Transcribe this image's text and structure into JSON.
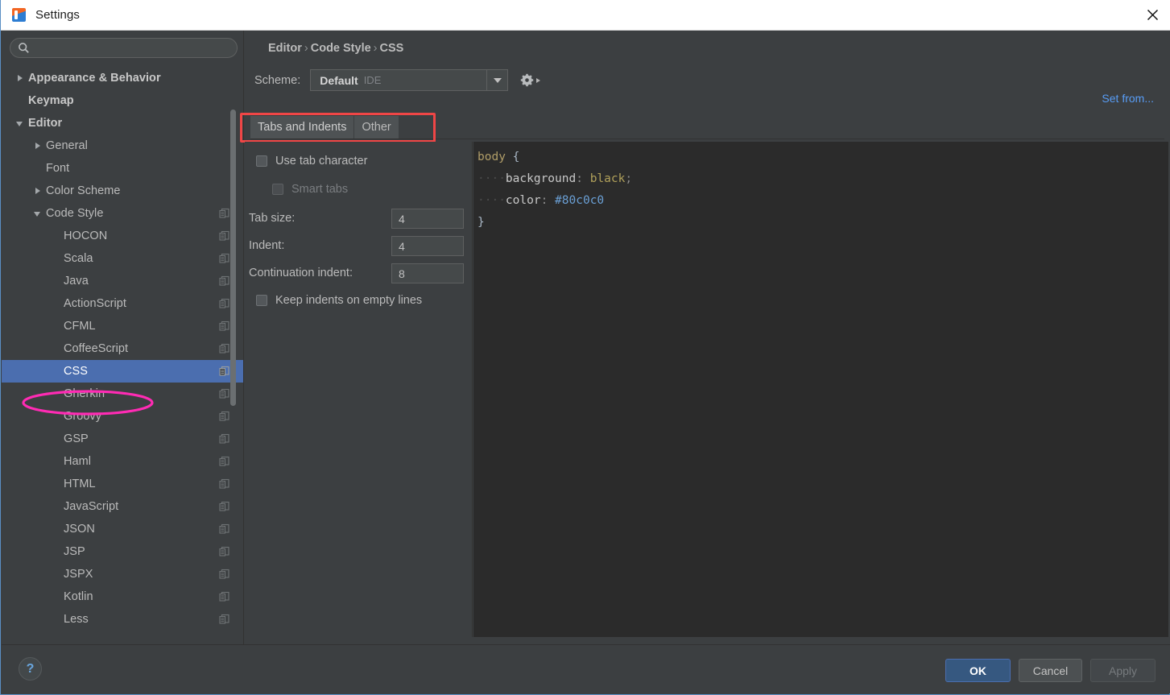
{
  "window": {
    "title": "Settings",
    "app_icon": "intellij-idea-icon",
    "close_icon": "close-icon"
  },
  "sidebar": {
    "search": {
      "icon": "search-icon",
      "value": "",
      "placeholder": ""
    },
    "items": [
      {
        "label": "Appearance & Behavior",
        "indent": 0,
        "twisty": "collapsed",
        "bold": true,
        "selected": false,
        "copy": false
      },
      {
        "label": "Keymap",
        "indent": 0,
        "twisty": "none",
        "bold": true,
        "selected": false,
        "copy": false
      },
      {
        "label": "Editor",
        "indent": 0,
        "twisty": "expanded",
        "bold": true,
        "selected": false,
        "copy": false
      },
      {
        "label": "General",
        "indent": 1,
        "twisty": "collapsed",
        "bold": false,
        "selected": false,
        "copy": false
      },
      {
        "label": "Font",
        "indent": 1,
        "twisty": "none",
        "bold": false,
        "selected": false,
        "copy": false
      },
      {
        "label": "Color Scheme",
        "indent": 1,
        "twisty": "collapsed",
        "bold": false,
        "selected": false,
        "copy": false
      },
      {
        "label": "Code Style",
        "indent": 1,
        "twisty": "expanded",
        "bold": false,
        "selected": false,
        "copy": true
      },
      {
        "label": "HOCON",
        "indent": 2,
        "twisty": "none",
        "bold": false,
        "selected": false,
        "copy": true
      },
      {
        "label": "Scala",
        "indent": 2,
        "twisty": "none",
        "bold": false,
        "selected": false,
        "copy": true
      },
      {
        "label": "Java",
        "indent": 2,
        "twisty": "none",
        "bold": false,
        "selected": false,
        "copy": true
      },
      {
        "label": "ActionScript",
        "indent": 2,
        "twisty": "none",
        "bold": false,
        "selected": false,
        "copy": true
      },
      {
        "label": "CFML",
        "indent": 2,
        "twisty": "none",
        "bold": false,
        "selected": false,
        "copy": true
      },
      {
        "label": "CoffeeScript",
        "indent": 2,
        "twisty": "none",
        "bold": false,
        "selected": false,
        "copy": true
      },
      {
        "label": "CSS",
        "indent": 2,
        "twisty": "none",
        "bold": false,
        "selected": true,
        "copy": true
      },
      {
        "label": "Gherkin",
        "indent": 2,
        "twisty": "none",
        "bold": false,
        "selected": false,
        "copy": true
      },
      {
        "label": "Groovy",
        "indent": 2,
        "twisty": "none",
        "bold": false,
        "selected": false,
        "copy": true
      },
      {
        "label": "GSP",
        "indent": 2,
        "twisty": "none",
        "bold": false,
        "selected": false,
        "copy": true
      },
      {
        "label": "Haml",
        "indent": 2,
        "twisty": "none",
        "bold": false,
        "selected": false,
        "copy": true
      },
      {
        "label": "HTML",
        "indent": 2,
        "twisty": "none",
        "bold": false,
        "selected": false,
        "copy": true
      },
      {
        "label": "JavaScript",
        "indent": 2,
        "twisty": "none",
        "bold": false,
        "selected": false,
        "copy": true
      },
      {
        "label": "JSON",
        "indent": 2,
        "twisty": "none",
        "bold": false,
        "selected": false,
        "copy": true
      },
      {
        "label": "JSP",
        "indent": 2,
        "twisty": "none",
        "bold": false,
        "selected": false,
        "copy": true
      },
      {
        "label": "JSPX",
        "indent": 2,
        "twisty": "none",
        "bold": false,
        "selected": false,
        "copy": true
      },
      {
        "label": "Kotlin",
        "indent": 2,
        "twisty": "none",
        "bold": false,
        "selected": false,
        "copy": true
      },
      {
        "label": "Less",
        "indent": 2,
        "twisty": "none",
        "bold": false,
        "selected": false,
        "copy": true
      }
    ],
    "selected_annotation": {
      "shape": "ellipse",
      "color": "#ff2bb4",
      "target": "CSS"
    }
  },
  "header": {
    "breadcrumb": [
      "Editor",
      "Code Style",
      "CSS"
    ],
    "breadcrumb_separator": "›",
    "scheme_label": "Scheme:",
    "scheme_value": "Default",
    "scheme_scope": "IDE",
    "scheme_dropdown_icon": "chevron-down-icon",
    "gear_icon": "gear-icon",
    "set_from_link": "Set from..."
  },
  "tabs": {
    "items": [
      {
        "label": "Tabs and Indents",
        "active": true
      },
      {
        "label": "Other",
        "active": false
      }
    ],
    "annotation": {
      "shape": "rectangle",
      "color": "#f04646"
    }
  },
  "options": {
    "use_tab_character": {
      "label": "Use tab character",
      "checked": false,
      "disabled": false
    },
    "smart_tabs": {
      "label": "Smart tabs",
      "checked": false,
      "disabled": true
    },
    "tab_size": {
      "label": "Tab size:",
      "value": "4"
    },
    "indent": {
      "label": "Indent:",
      "value": "4"
    },
    "continuation_indent": {
      "label": "Continuation indent:",
      "value": "8"
    },
    "keep_indents": {
      "label": "Keep indents on empty lines",
      "checked": false,
      "disabled": false
    }
  },
  "preview": {
    "language": "CSS",
    "lines": [
      {
        "tokens": [
          {
            "t": "body",
            "c": "tok-tag"
          },
          {
            "t": " ",
            "c": "tok-punc"
          },
          {
            "t": "{",
            "c": "tok-brace"
          }
        ]
      },
      {
        "tokens": [
          {
            "t": "····",
            "c": "wsdot"
          },
          {
            "t": "background",
            "c": "tok-prop"
          },
          {
            "t": ":",
            "c": "tok-punc"
          },
          {
            "t": " ",
            "c": "tok-punc"
          },
          {
            "t": "black",
            "c": "tok-val"
          },
          {
            "t": ";",
            "c": "tok-punc"
          }
        ]
      },
      {
        "tokens": [
          {
            "t": "····",
            "c": "wsdot"
          },
          {
            "t": "color",
            "c": "tok-prop"
          },
          {
            "t": ":",
            "c": "tok-punc"
          },
          {
            "t": " ",
            "c": "tok-punc"
          },
          {
            "t": "#80c0c0",
            "c": "tok-color"
          }
        ]
      },
      {
        "tokens": [
          {
            "t": "}",
            "c": "tok-brace"
          }
        ]
      }
    ]
  },
  "footer": {
    "help_icon": "help-question-icon",
    "help_label": "?",
    "ok": "OK",
    "cancel": "Cancel",
    "apply": "Apply",
    "apply_disabled": true
  },
  "colors": {
    "window_bg": "#3c3f41",
    "titlebar_bg": "#ffffff",
    "selection_blue": "#4b6eaf",
    "editor_bg": "#2b2b2b",
    "link_blue": "#589df6",
    "annotation_red": "#f04646",
    "annotation_pink": "#ff2bb4",
    "default_button_bg": "#365880"
  }
}
